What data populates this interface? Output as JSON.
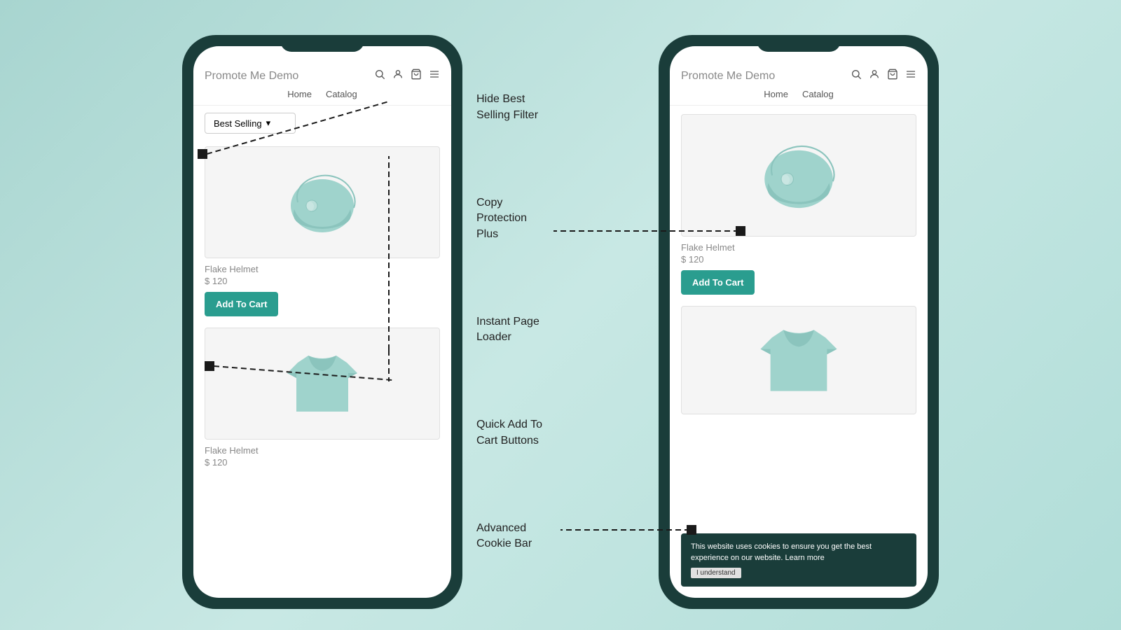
{
  "background": "#b8dbd8",
  "phones": {
    "left": {
      "title": "Promote Me Demo",
      "nav": [
        "Home",
        "Catalog"
      ],
      "filter": {
        "label": "Best Selling",
        "icon": "▾"
      },
      "products": [
        {
          "name": "Flake Helmet",
          "price": "$ 120",
          "hasButton": true,
          "buttonLabel": "Add To Cart"
        },
        {
          "name": "Flake Helmet",
          "price": "$ 120",
          "hasButton": false
        }
      ]
    },
    "right": {
      "title": "Promote Me Demo",
      "nav": [
        "Home",
        "Catalog"
      ],
      "products": [
        {
          "name": "Flake Helmet",
          "price": "$ 120",
          "hasButton": true,
          "buttonLabel": "Add To Cart"
        },
        {
          "name": "",
          "price": "",
          "hasButton": false
        }
      ],
      "cookieBar": {
        "text": "This website uses cookies to ensure you get the best experience on our website. Learn more",
        "buttonLabel": "I understand"
      }
    }
  },
  "features": [
    {
      "id": "hide-best-selling",
      "label": "Hide Best\nSelling Filter"
    },
    {
      "id": "copy-protection",
      "label": "Copy\nProtection\nPlus"
    },
    {
      "id": "instant-page",
      "label": "Instant Page\nLoader"
    },
    {
      "id": "quick-add",
      "label": "Quick Add To\nCart Buttons"
    },
    {
      "id": "cookie-bar",
      "label": "Advanced\nCookie Bar"
    }
  ],
  "icons": {
    "search": "🔍",
    "user": "👤",
    "cart": "🛍",
    "menu": "☰"
  }
}
